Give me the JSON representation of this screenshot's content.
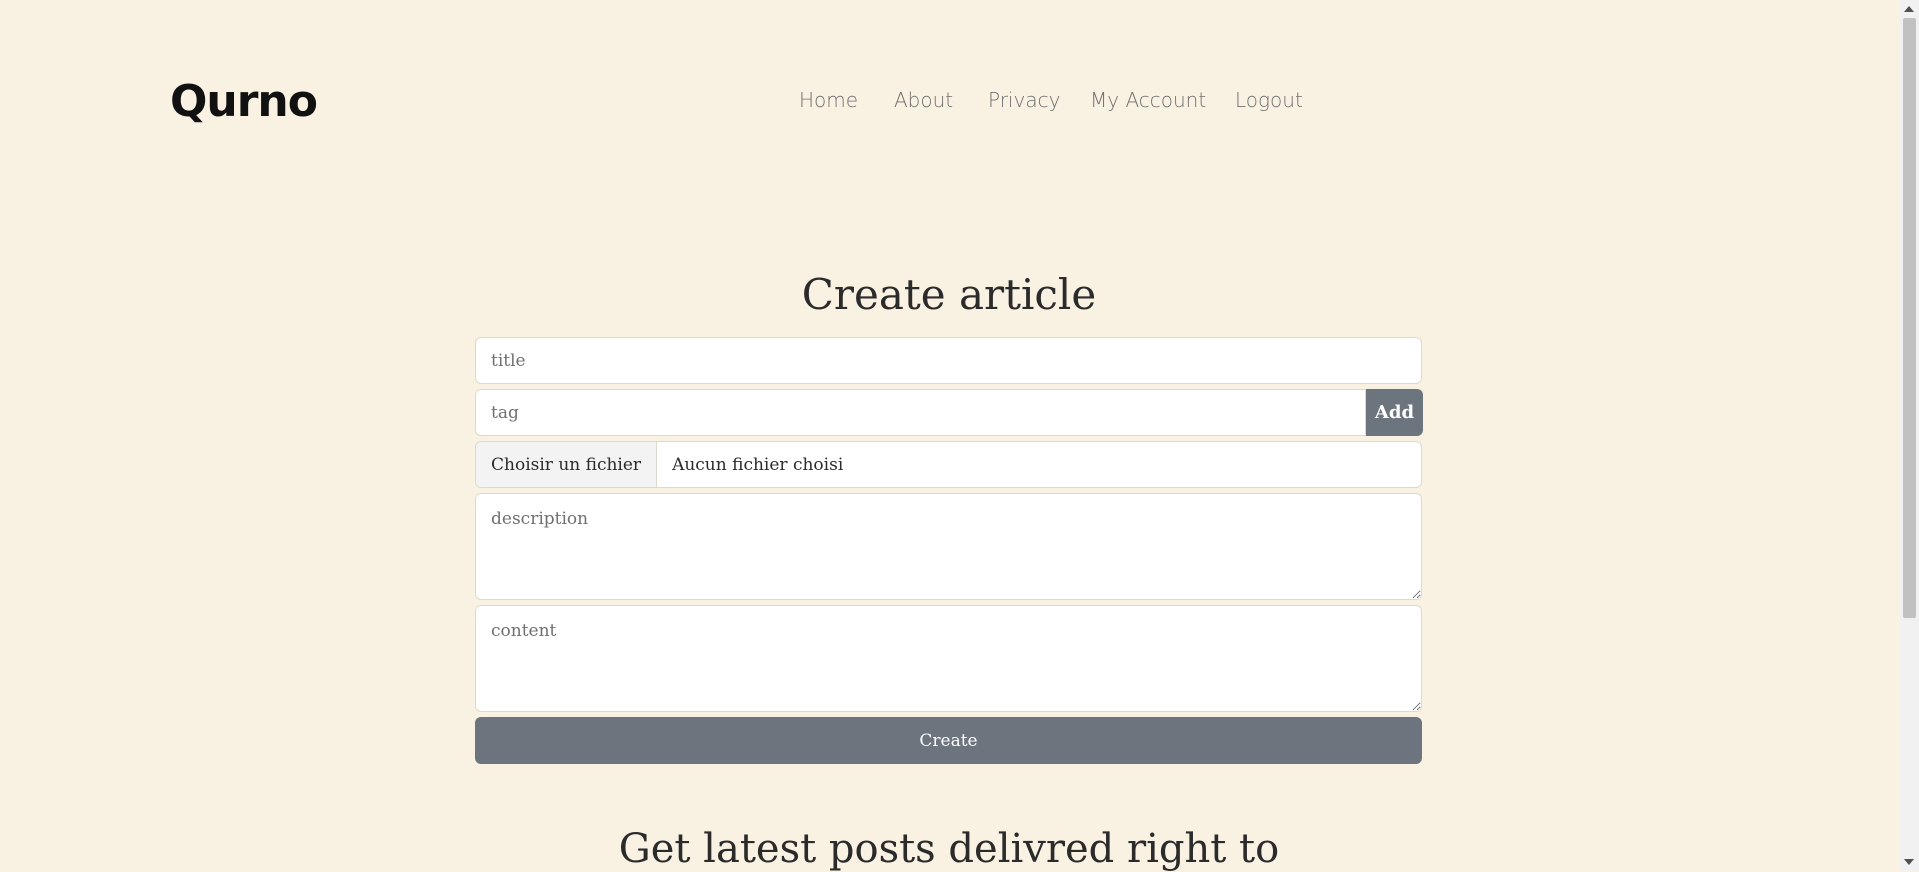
{
  "brand": {
    "logo": "Qurno"
  },
  "nav": {
    "items": [
      {
        "label": "Home"
      },
      {
        "label": "About"
      },
      {
        "label": "Privacy"
      },
      {
        "label": "My Account"
      },
      {
        "label": "Logout"
      }
    ]
  },
  "form": {
    "heading": "Create article",
    "title_placeholder": "title",
    "tag_placeholder": "tag",
    "add_label": "Add",
    "file_button_label": "Choisir un fichier",
    "file_status": "Aucun fichier choisi",
    "description_placeholder": "description",
    "content_placeholder": "content",
    "create_label": "Create"
  },
  "newsletter": {
    "heading": "Get latest posts delivred right to"
  }
}
